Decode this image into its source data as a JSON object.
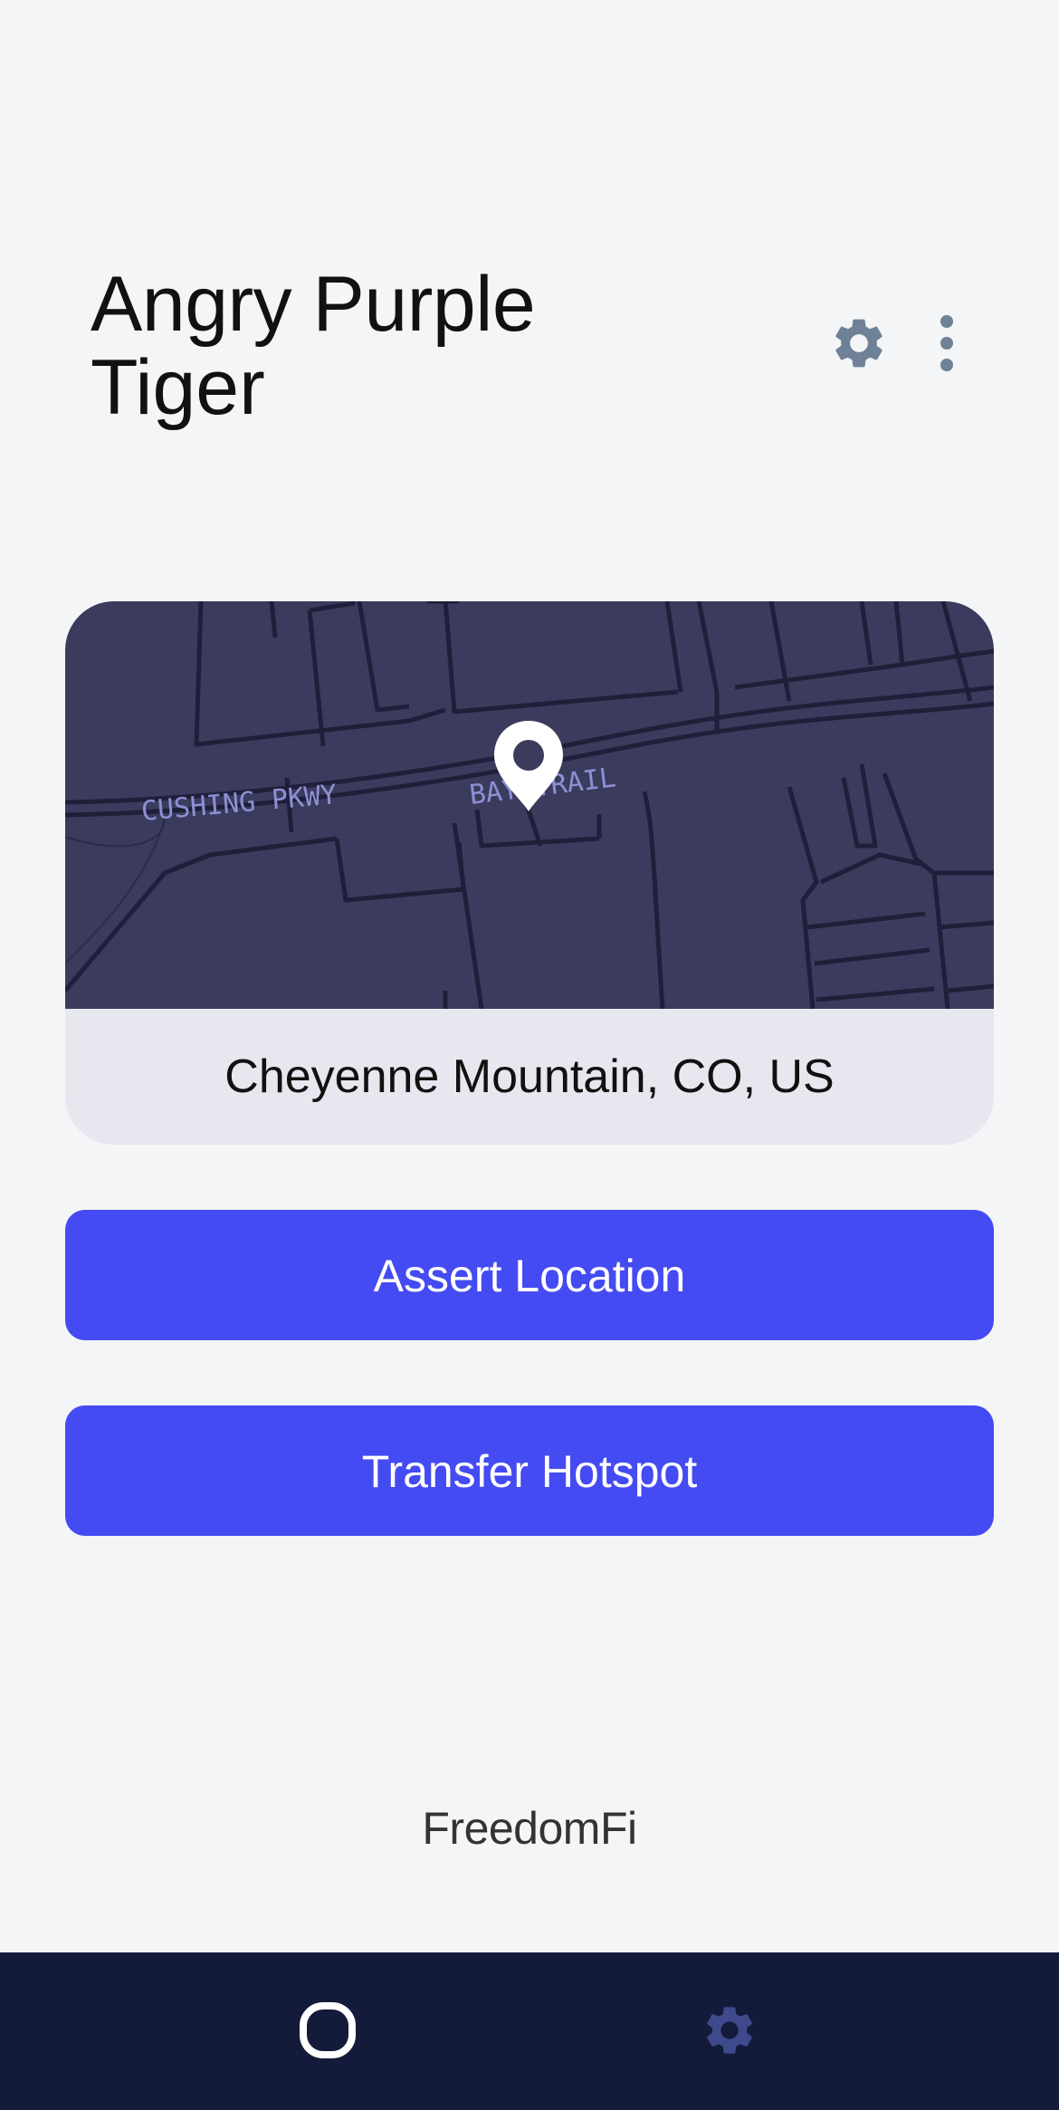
{
  "header": {
    "title_line1": "Angry Purple",
    "title_line2": "Tiger",
    "settings_icon": "gear-icon",
    "more_icon": "more-vertical-icon"
  },
  "map": {
    "street_labels": [
      "CUSHING PKWY",
      "BAY TRAIL"
    ],
    "marker_icon": "map-pin-icon",
    "location": "Cheyenne Mountain, CO, US"
  },
  "actions": {
    "assert_location": "Assert Location",
    "transfer_hotspot": "Transfer Hotspot"
  },
  "brand": "FreedomFi",
  "tabbar": {
    "home_icon": "home-square-icon",
    "settings_icon": "gear-icon"
  },
  "colors": {
    "background": "#f4f5f6",
    "primary": "#444bf2",
    "map_bg": "#3b3b5e",
    "tabbar_bg": "#141a3a",
    "icon_gray": "#6e8196",
    "tab_inactive": "#3e4a8c"
  }
}
